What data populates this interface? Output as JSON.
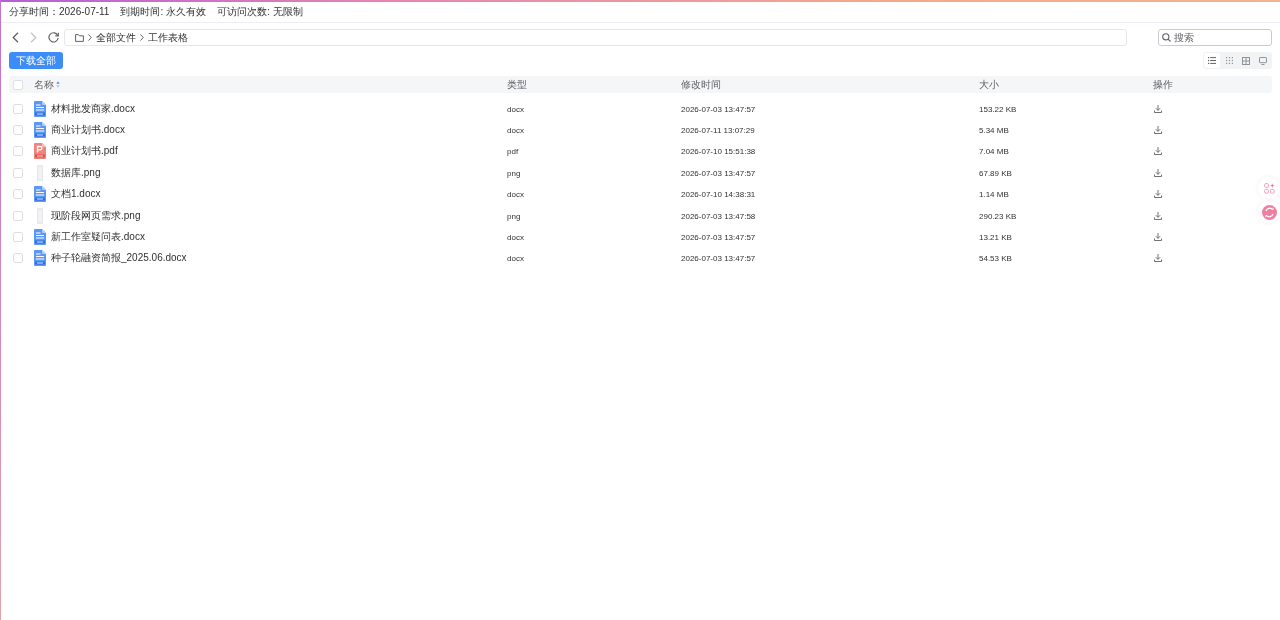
{
  "share_info": {
    "items": [
      "分享时间：2026-07-11",
      "到期时间: 永久有效",
      "可访问次数: 无限制"
    ]
  },
  "navigation": {
    "buttons": [
      {
        "kind": "back",
        "disabled": false
      },
      {
        "kind": "forward",
        "disabled": true
      },
      {
        "kind": "refresh",
        "disabled": false
      }
    ],
    "breadcrumb": [
      "全部文件",
      "工作表格"
    ]
  },
  "search": {
    "placeholder": "搜索"
  },
  "toolbar": {
    "download_all": "下载全部",
    "views": [
      {
        "kind": "list",
        "selected": true
      },
      {
        "kind": "dots",
        "selected": false
      },
      {
        "kind": "grid",
        "selected": false
      },
      {
        "kind": "screen",
        "selected": false
      }
    ]
  },
  "table": {
    "select_all": {
      "checked": false
    },
    "columns": [
      {
        "label": "名称",
        "sorted": true
      },
      {
        "label": "类型",
        "sorted": false
      },
      {
        "label": "修改时间",
        "sorted": false
      },
      {
        "label": "大小",
        "sorted": false
      },
      {
        "label": "操作",
        "sorted": false
      }
    ],
    "rows": [
      {
        "name": "材料批发商家.docx",
        "kind": "doc",
        "type": "docx",
        "modified": "2026-07-03 13:47:57",
        "size": "153.22 KB",
        "checked": false
      },
      {
        "name": "商业计划书.docx",
        "kind": "doc",
        "type": "docx",
        "modified": "2026-07-11 13:07:29",
        "size": "5.34 MB",
        "checked": false
      },
      {
        "name": "商业计划书.pdf",
        "kind": "pdf",
        "type": "pdf",
        "modified": "2026-07-10 15:51:38",
        "size": "7.04 MB",
        "checked": false
      },
      {
        "name": "数据库.png",
        "kind": "image",
        "type": "png",
        "modified": "2026-07-03 13:47:57",
        "size": "67.89 KB",
        "checked": false
      },
      {
        "name": "文档1.docx",
        "kind": "doc",
        "type": "docx",
        "modified": "2026-07-10 14:38:31",
        "size": "1.14 MB",
        "checked": false
      },
      {
        "name": "现阶段网页需求.png",
        "kind": "image",
        "type": "png",
        "modified": "2026-07-03 13:47:58",
        "size": "290.23 KB",
        "checked": false
      },
      {
        "name": "新工作室疑问表.docx",
        "kind": "doc",
        "type": "docx",
        "modified": "2026-07-03 13:47:57",
        "size": "13.21 KB",
        "checked": false
      },
      {
        "name": "种子轮融资简报_2025.06.docx",
        "kind": "doc",
        "type": "docx",
        "modified": "2026-07-03 13:47:57",
        "size": "54.53 KB",
        "checked": false
      }
    ]
  },
  "side_widgets": [
    {
      "kind": "apps"
    },
    {
      "kind": "translate"
    }
  ]
}
